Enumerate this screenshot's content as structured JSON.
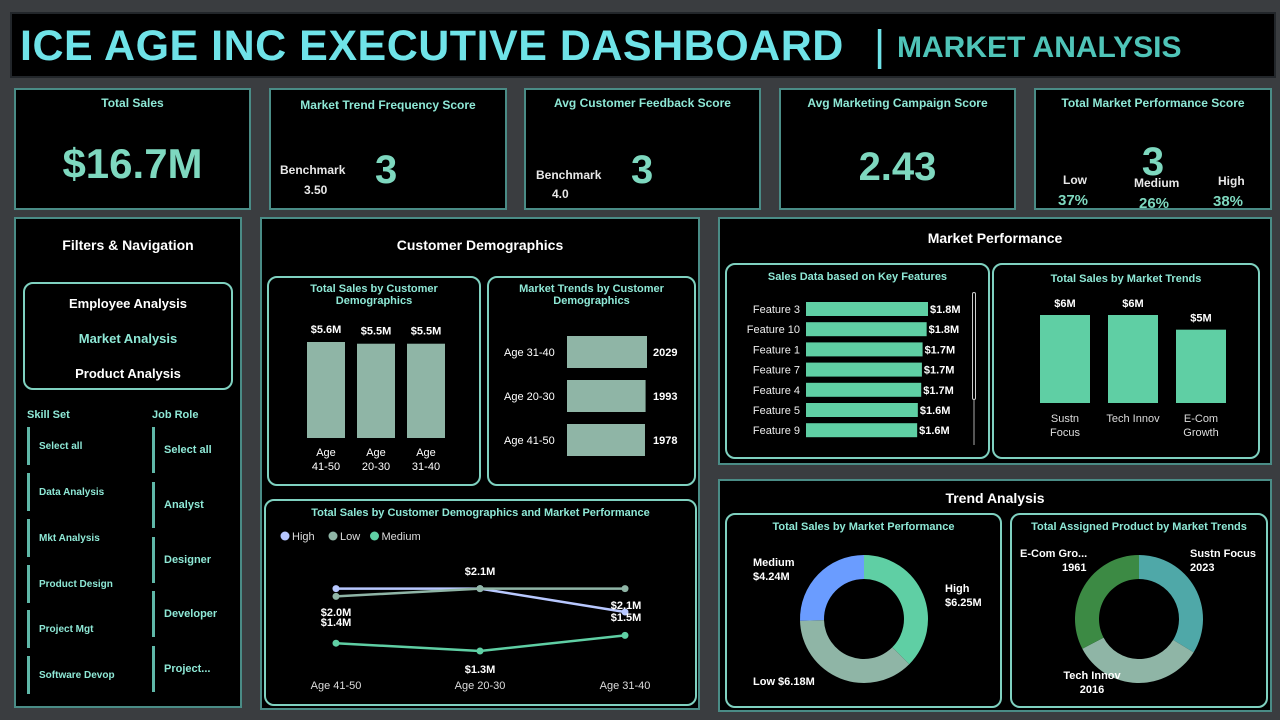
{
  "header": {
    "title": "ICE AGE INC EXECUTIVE DASHBOARD",
    "separator": "|",
    "subtitle": "MARKET ANALYSIS"
  },
  "kpis": {
    "total_sales": {
      "title": "Total Sales",
      "value": "$16.7M"
    },
    "market_trend_freq": {
      "title": "Market Trend Frequency Score",
      "benchmark_label": "Benchmark",
      "benchmark_value": "3.50",
      "value": "3"
    },
    "avg_feedback": {
      "title": "Avg Customer Feedback Score",
      "benchmark_label": "Benchmark",
      "benchmark_value": "4.0",
      "value": "3"
    },
    "avg_marketing": {
      "title": "Avg Marketing Campaign Score",
      "value": "2.43"
    },
    "total_market_perf": {
      "title": "Total Market Performance Score",
      "value": "3",
      "low_label": "Low",
      "low_value": "37%",
      "medium_label": "Medium",
      "medium_value": "26%",
      "high_label": "High",
      "high_value": "38%"
    }
  },
  "filters": {
    "title": "Filters & Navigation",
    "nav": [
      {
        "label": "Employee Analysis",
        "active": false
      },
      {
        "label": "Market Analysis",
        "active": true
      },
      {
        "label": "Product Analysis",
        "active": false
      }
    ],
    "skill_set_title": "Skill Set",
    "skill_set": [
      "Select all",
      "Data Analysis",
      "Mkt Analysis",
      "Product Design",
      "Project Mgt",
      "Software Devop"
    ],
    "job_role_title": "Job Role",
    "job_role": [
      "Select all",
      "Analyst",
      "Designer",
      "Developer",
      "Project..."
    ]
  },
  "demographics": {
    "title": "Customer Demographics",
    "sales_by_demo_title": "Total Sales by Customer Demographics",
    "trends_by_demo_title": "Market Trends by Customer Demographics",
    "combo_title": "Total Sales by Customer Demographics and Market Performance"
  },
  "market_performance": {
    "title": "Market Performance",
    "key_features_title": "Sales Data based on Key Features",
    "sales_by_trends_title": "Total Sales by Market Trends"
  },
  "trend_analysis": {
    "title": "Trend Analysis",
    "sales_by_perf_title": "Total Sales by Market Performance",
    "assigned_by_trends_title": "Total Assigned Product by Market Trends"
  },
  "colors": {
    "accent": "#7ed8bf",
    "title_cyan": "#6fe3e8",
    "bar_gray": "#8fb5a6",
    "bar_green": "#5fcfa4",
    "high": "#b8c8ff",
    "low": "#8fb5a6",
    "medium": "#5fcfa4"
  },
  "chart_data": [
    {
      "id": "sales_by_demographics",
      "type": "bar",
      "title": "Total Sales by Customer Demographics",
      "categories": [
        "Age 41-50",
        "Age 20-30",
        "Age 31-40"
      ],
      "values": [
        5.6,
        5.5,
        5.5
      ],
      "data_labels": [
        "$5.6M",
        "$5.5M",
        "$5.5M"
      ],
      "unit": "$M"
    },
    {
      "id": "market_trends_by_demographics",
      "type": "bar",
      "orientation": "horizontal",
      "title": "Market Trends by Customer Demographics",
      "categories": [
        "Age 31-40",
        "Age 20-30",
        "Age 41-50"
      ],
      "values": [
        2029,
        1993,
        1978
      ],
      "data_labels": [
        "2029",
        "1993",
        "1978"
      ]
    },
    {
      "id": "sales_by_demo_and_perf",
      "type": "line",
      "title": "Total Sales by Customer Demographics and Market Performance",
      "categories": [
        "Age 41-50",
        "Age 20-30",
        "Age 31-40"
      ],
      "legend": "top-left",
      "series": [
        {
          "name": "High",
          "values": [
            2.1,
            2.1,
            1.8
          ],
          "labels": [
            "",
            "$2.1M",
            "$2.1M"
          ]
        },
        {
          "name": "Low",
          "values": [
            2.0,
            2.1,
            2.1
          ],
          "labels": [
            "$2.0M",
            "",
            ""
          ]
        },
        {
          "name": "Medium",
          "values": [
            1.4,
            1.3,
            1.5
          ],
          "labels": [
            "$1.4M",
            "$1.3M",
            "$1.5M"
          ]
        }
      ]
    },
    {
      "id": "sales_by_key_features",
      "type": "bar",
      "orientation": "horizontal",
      "title": "Sales Data based on Key Features",
      "categories": [
        "Feature 3",
        "Feature 10",
        "Feature 1",
        "Feature 7",
        "Feature 4",
        "Feature 5",
        "Feature 9"
      ],
      "values": [
        1.8,
        1.78,
        1.72,
        1.71,
        1.7,
        1.65,
        1.64
      ],
      "data_labels": [
        "$1.8M",
        "$1.8M",
        "$1.7M",
        "$1.7M",
        "$1.7M",
        "$1.6M",
        "$1.6M"
      ]
    },
    {
      "id": "sales_by_market_trends",
      "type": "bar",
      "title": "Total Sales by Market Trends",
      "categories": [
        "Sustn Focus",
        "Tech Innov",
        "E-Com Growth"
      ],
      "values": [
        6.0,
        6.0,
        5.0
      ],
      "data_labels": [
        "$6M",
        "$6M",
        "$5M"
      ]
    },
    {
      "id": "sales_by_market_performance",
      "type": "pie",
      "title": "Total Sales by Market Performance",
      "labels": [
        "High",
        "Low",
        "Medium"
      ],
      "values": [
        6.25,
        6.18,
        4.24
      ],
      "data_labels": [
        "$6.25M",
        "$6.18M",
        "$4.24M"
      ],
      "colors": [
        "#5fcfa4",
        "#8fb5a6",
        "#6a9cff"
      ]
    },
    {
      "id": "assigned_product_by_trends",
      "type": "pie",
      "title": "Total Assigned Product by Market Trends",
      "labels": [
        "Sustn Focus",
        "Tech Innov",
        "E-Com Gro..."
      ],
      "values": [
        2023,
        2016,
        1961
      ],
      "colors": [
        "#4fa8a8",
        "#8fb5a6",
        "#3c8a44"
      ]
    }
  ]
}
